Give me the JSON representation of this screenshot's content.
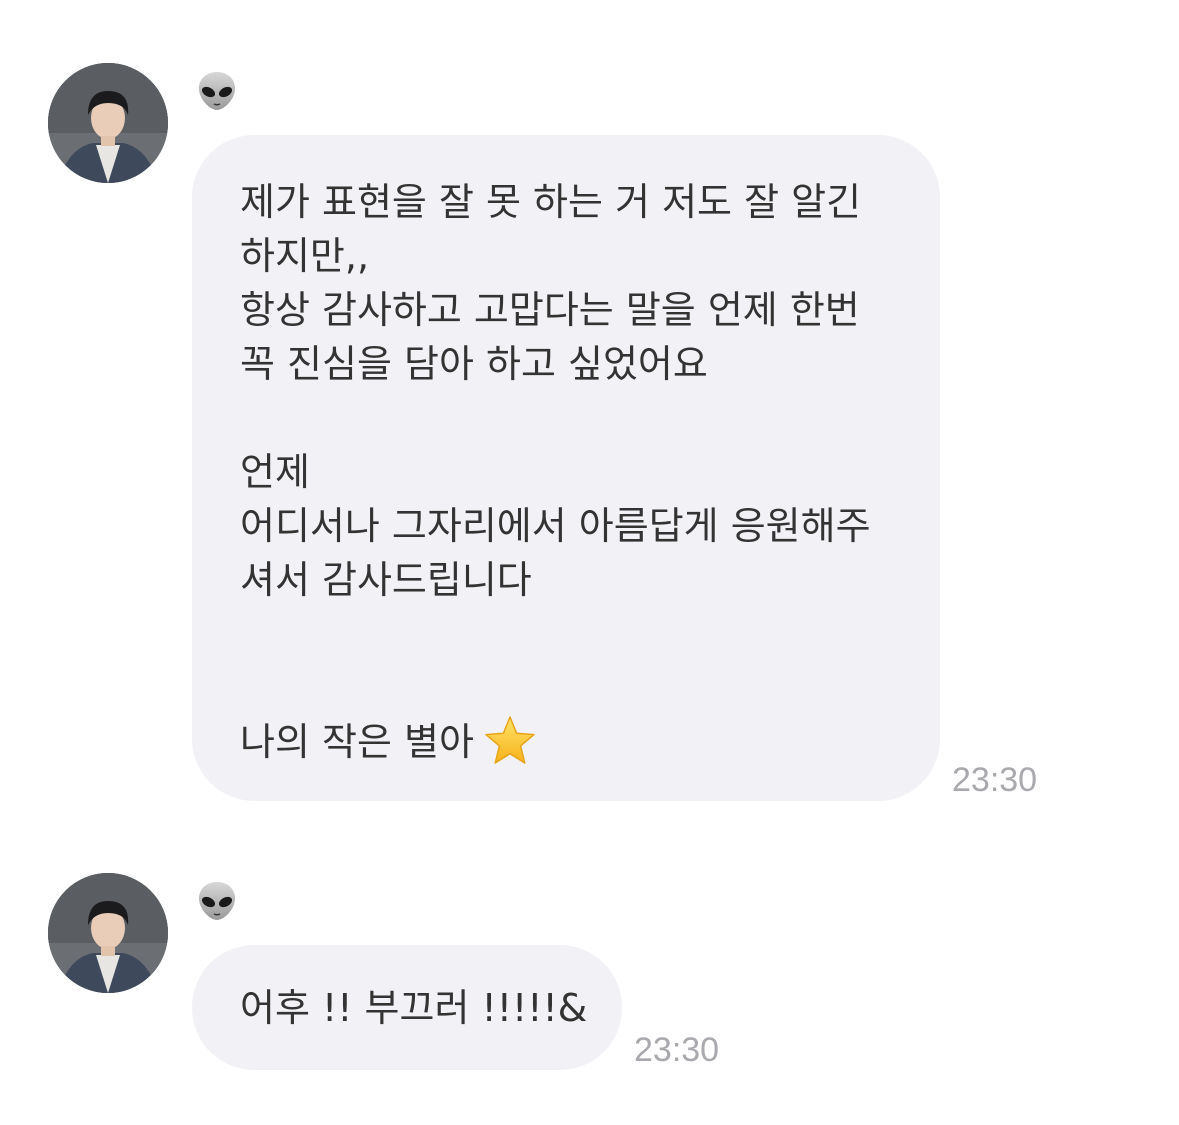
{
  "messages": [
    {
      "sender": "👽",
      "text": "제가 표현을 잘 못 하는 거 저도 잘 알긴\n하지만,,\n항상 감사하고 고맙다는 말을 언제 한번\n꼭 진심을 담아 하고 싶었어요\n\n언제\n어디서나 그자리에서 아름답게 응원해주\n셔서 감사드립니다\n\n\n나의 작은 별아",
      "emoji": "star",
      "time": "23:30"
    },
    {
      "sender": "👽",
      "text": "어후 !! 부끄러 !!!!!&",
      "time": "23:30"
    }
  ],
  "colors": {
    "bubble": "#f2f2f6",
    "text": "#333333",
    "timestamp": "#a9a9ae"
  }
}
